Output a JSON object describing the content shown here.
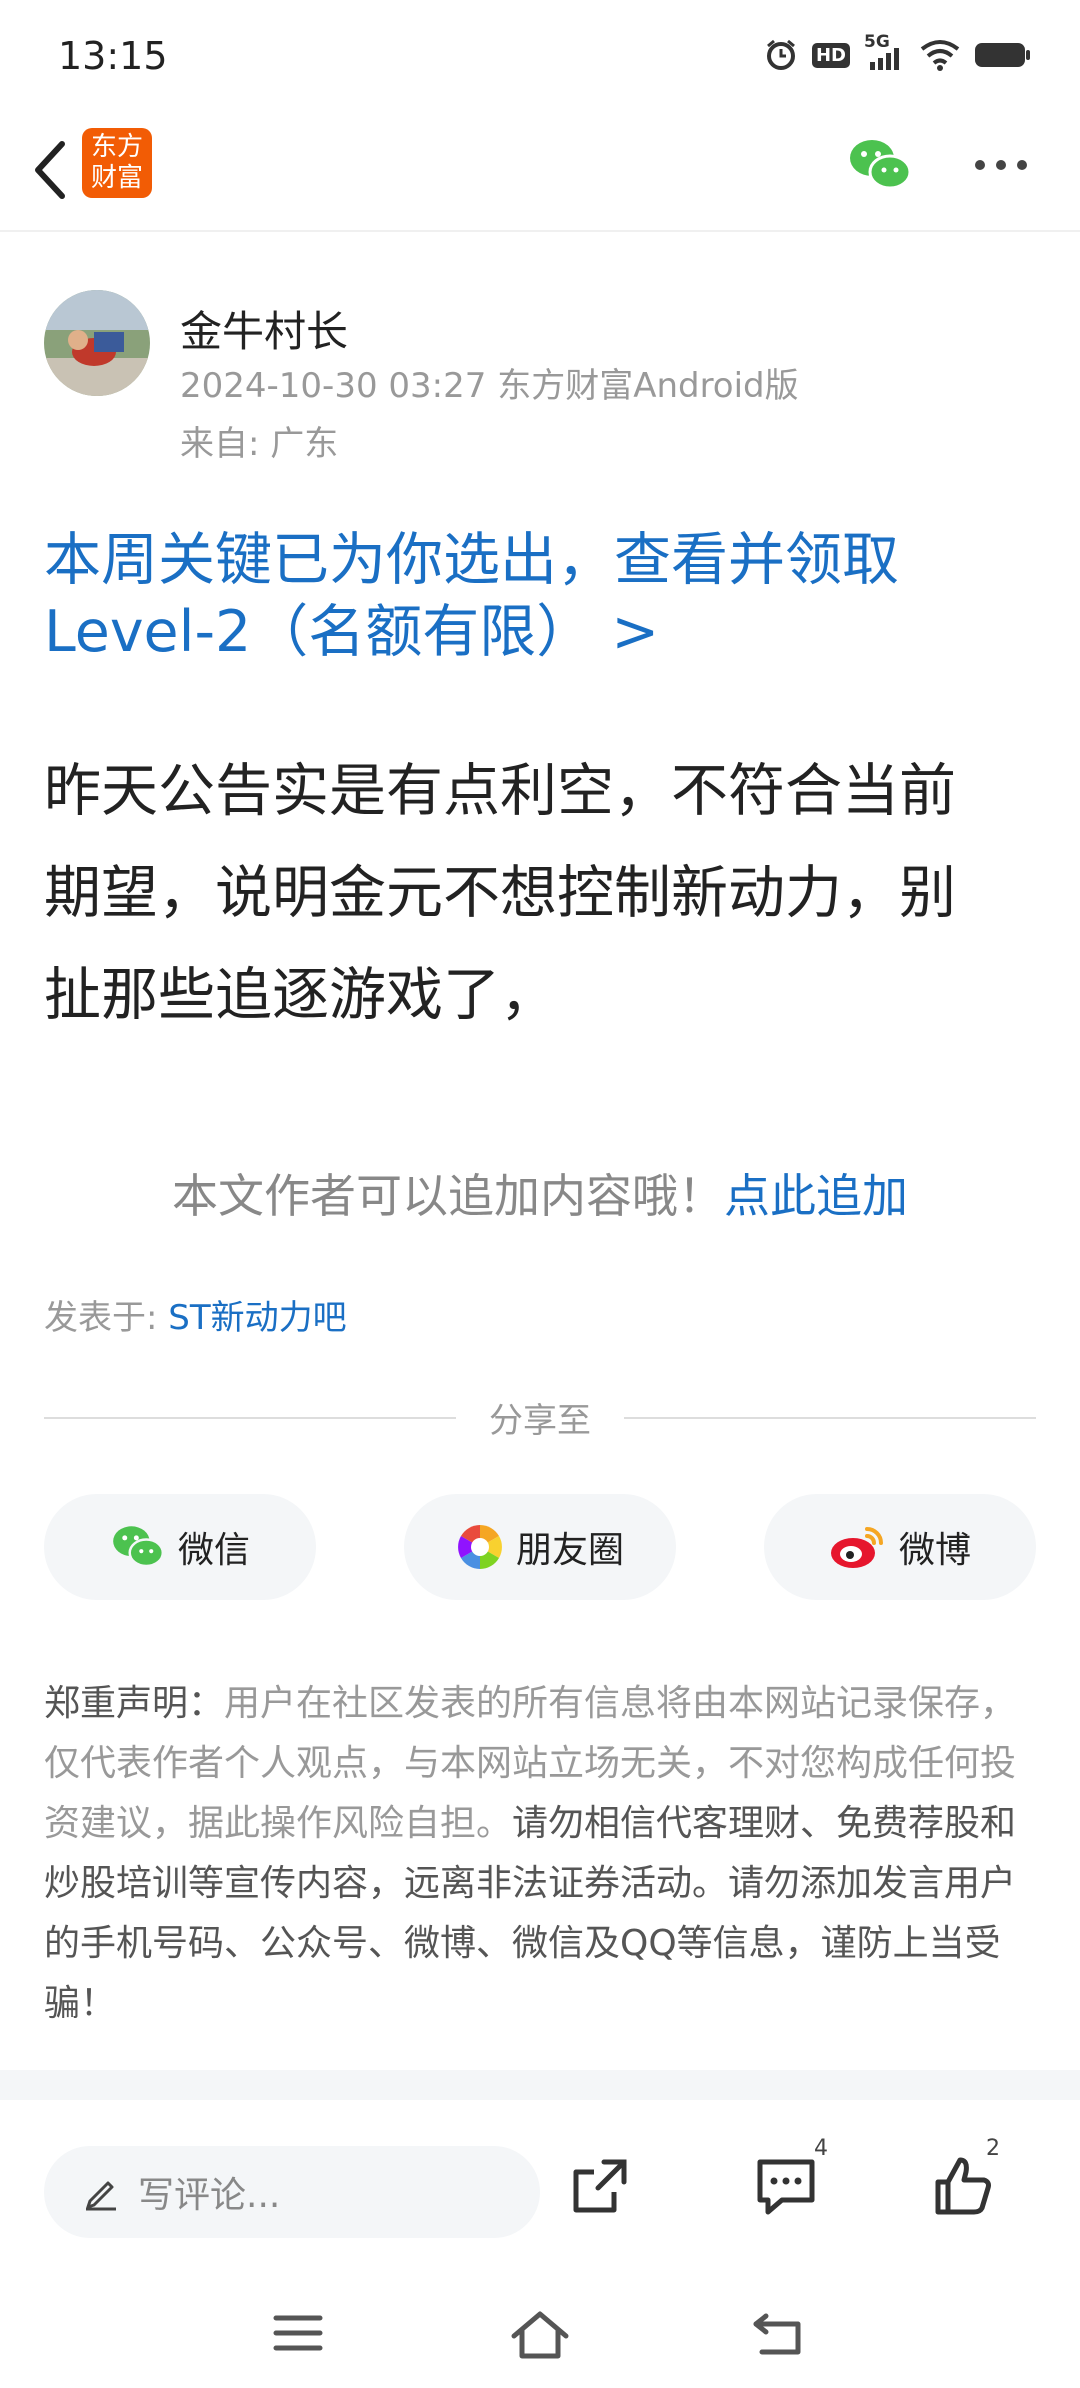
{
  "status_bar": {
    "time": "13:15",
    "icons": [
      "alarm-icon",
      "hd-icon",
      "5g-signal-icon",
      "wifi-icon",
      "battery-icon"
    ],
    "network_label": "5G",
    "hd_label": "HD"
  },
  "header": {
    "logo_text_line1": "东方",
    "logo_text_line2": "财富",
    "brand_color": "#f25c05",
    "wechat_color": "#4cc24f"
  },
  "author": {
    "name": "金牛村长",
    "meta": "2024-10-30 03:27 东方财富Android版",
    "location": "来自: 广东"
  },
  "promo": {
    "line1": "本周关键已为你选出，查看并领取",
    "line2": "Level-2（名额有限） >",
    "color": "#1a6fc4"
  },
  "post": {
    "line1": "昨天公告实是有点利空，不符合当前",
    "line2": "期望，说明金元不想控制新动力，别",
    "line3": "扯那些追逐游戏了，"
  },
  "append": {
    "text": "本文作者可以追加内容哦！",
    "link": "点此追加"
  },
  "posted_in": {
    "prefix": "发表于: ",
    "forum": "ST新动力吧"
  },
  "share": {
    "title": "分享至",
    "buttons": [
      {
        "label": "微信",
        "icon": "wechat-icon"
      },
      {
        "label": "朋友圈",
        "icon": "moments-icon"
      },
      {
        "label": "微博",
        "icon": "weibo-icon"
      }
    ]
  },
  "disclaimer": {
    "head": "郑重声明：",
    "body": "用户在社区发表的所有信息将由本网站记录保存，仅代表作者个人观点，与本网站立场无关，不对您构成任何投资建议，据此操作风险自担。",
    "warning": "请勿相信代客理财、免费荐股和炒股培训等宣传内容，远离非法证券活动。请勿添加发言用户的手机号码、公众号、微博、微信及QQ等信息，谨防上当受骗！"
  },
  "bottom_bar": {
    "comment_placeholder": "写评论...",
    "comment_count": "4",
    "like_count": "2"
  },
  "system_nav": [
    "menu-icon",
    "home-icon",
    "back-icon"
  ]
}
